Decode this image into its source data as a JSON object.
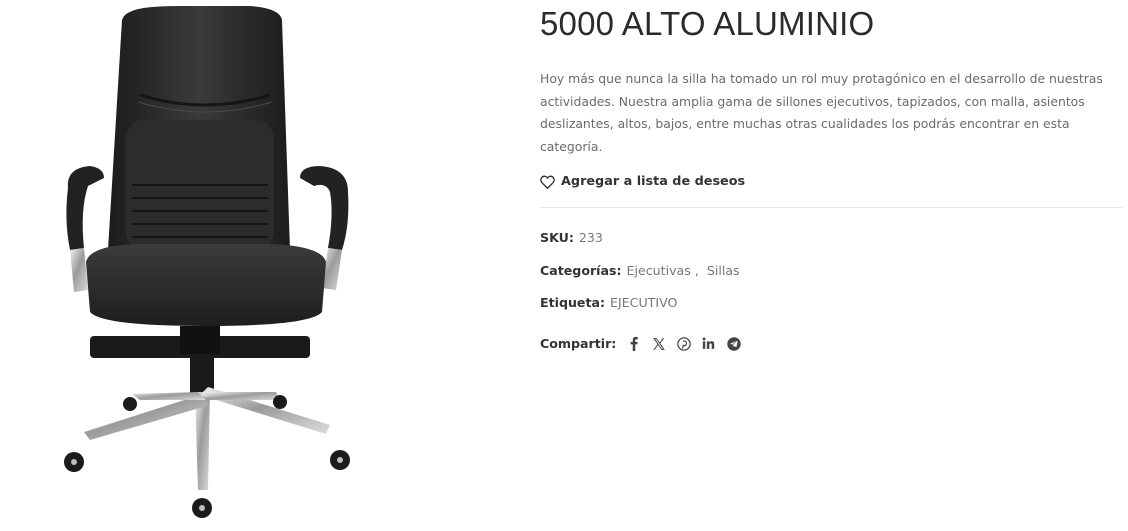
{
  "product": {
    "title": "5000 ALTO ALUMINIO",
    "description": "Hoy más que nunca la silla ha tomado un rol muy protagónico en el desarrollo de nuestras actividades. Nuestra amplia gama de sillones ejecutivos, tapizados, con malla, asientos deslizantes, altos, bajos, entre muchas otras cualidades los podrás encontrar en esta categoría.",
    "wishlist_label": "Agregar a lista de deseos",
    "sku_label": "SKU:",
    "sku_value": "233",
    "categories_label": "Categorías:",
    "categories": [
      "Ejecutivas",
      "Sillas"
    ],
    "tag_label": "Etiqueta:",
    "tag_value": "EJECUTIVO",
    "share_label": "Compartir:",
    "share_icons": [
      "facebook-icon",
      "x-icon",
      "pinterest-icon",
      "linkedin-icon",
      "telegram-icon"
    ]
  }
}
